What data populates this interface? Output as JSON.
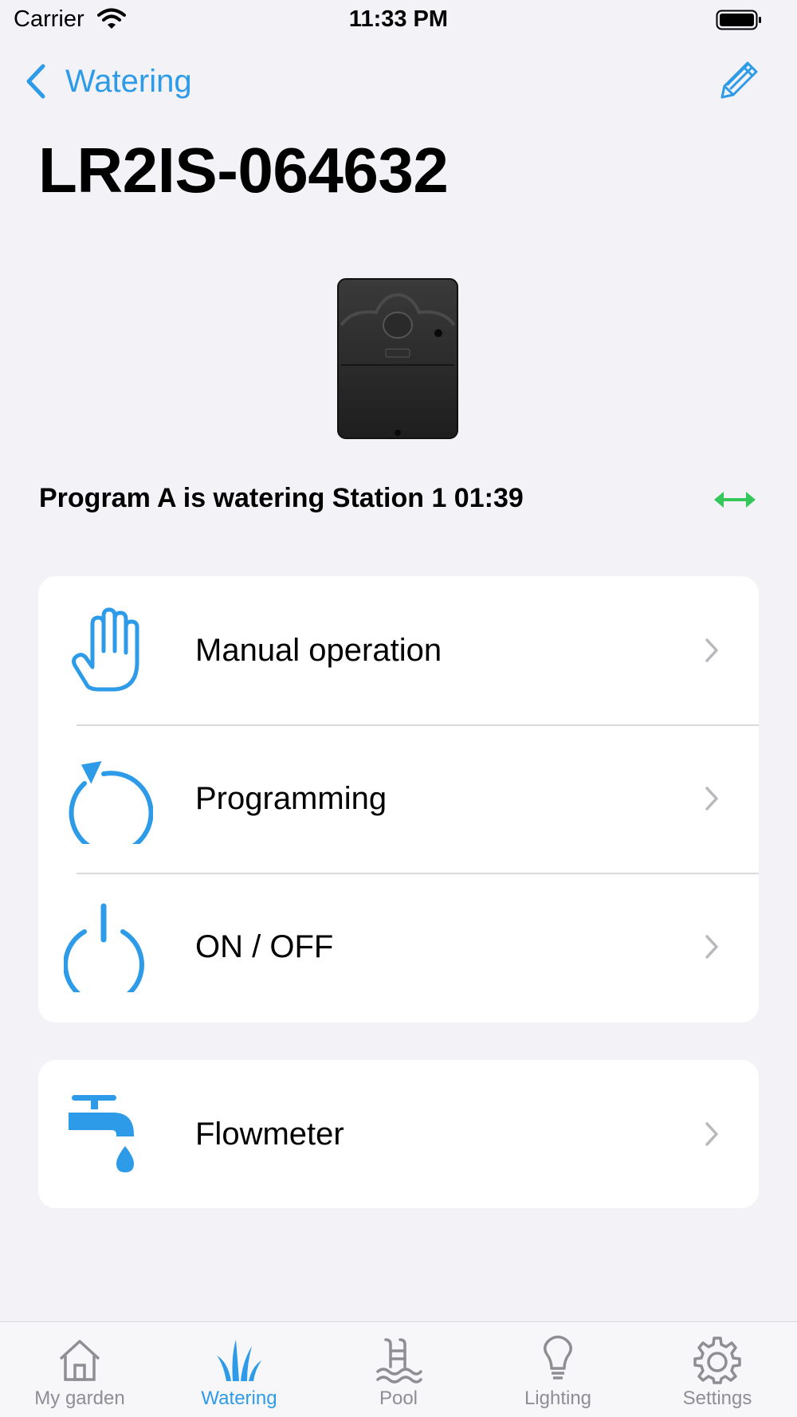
{
  "status_bar": {
    "carrier": "Carrier",
    "time": "11:33 PM"
  },
  "nav": {
    "back_label": "Watering"
  },
  "page": {
    "title": "LR2IS-064632",
    "status_message": "Program A is watering Station 1 01:39"
  },
  "menu": {
    "items": [
      {
        "label": "Manual operation",
        "icon": "hand-icon"
      },
      {
        "label": "Programming",
        "icon": "refresh-icon"
      },
      {
        "label": "ON / OFF",
        "icon": "power-icon"
      }
    ]
  },
  "flowmeter": {
    "label": "Flowmeter",
    "icon": "faucet-icon"
  },
  "tabs": [
    {
      "label": "My garden",
      "icon": "house-icon",
      "active": false
    },
    {
      "label": "Watering",
      "icon": "grass-icon",
      "active": true
    },
    {
      "label": "Pool",
      "icon": "pool-icon",
      "active": false
    },
    {
      "label": "Lighting",
      "icon": "bulb-icon",
      "active": false
    },
    {
      "label": "Settings",
      "icon": "gear-icon",
      "active": false
    }
  ],
  "colors": {
    "accent": "#2d9be8",
    "connected": "#34c759",
    "background": "#f2f2f7",
    "inactive": "#8e8e93"
  }
}
